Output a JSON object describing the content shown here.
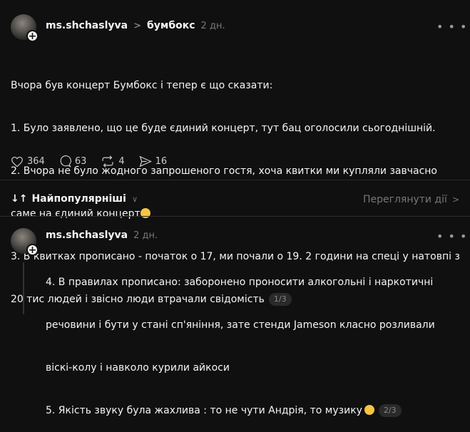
{
  "post": {
    "username": "ms.shchaslyva",
    "community": "бумбокс",
    "time": "2 дн.",
    "text_lines": [
      "Вчора був концерт Бумбокс і тепер є що сказати:",
      "1. Було заявлено, що це буде єдиний концерт, тут бац оголосили сьогоднішній.",
      "2. Вчора не було жодного запрошеного гостя, хоча квитки ми купляли завчасно",
      "саме на єдиний концерт",
      "3. В квитках прописано - початок о 17, ми почали о 19. 2 години на спеці у натовпі з",
      "20 тис людей і звісно люди втрачали свідомість"
    ],
    "pager": "1/3",
    "likes": "364",
    "comments": "63",
    "reposts": "4",
    "shares": "16"
  },
  "sort": {
    "label": "Найпопулярніші",
    "view_activity": "Переглянути дії"
  },
  "reply": {
    "username": "ms.shchaslyva",
    "time": "2 дн.",
    "text_lines": [
      "4. В правилах прописано: заборонено проносити алкогольні і наркотичні",
      "речовини і бути у стані сп'яніння, зате стенди Jameson класно розливали",
      "віскі-колу і навколо курили айкоси",
      "5. Якість звуку була жахлива : то не чути Андрія, то музику"
    ],
    "pager": "2/3"
  },
  "icons": {
    "like": "heart-icon",
    "comment": "comment-icon",
    "repost": "repost-icon",
    "share": "send-icon",
    "more": "more-icon",
    "sort": "sort-arrows-icon",
    "chevron": "chevron-down-icon"
  }
}
